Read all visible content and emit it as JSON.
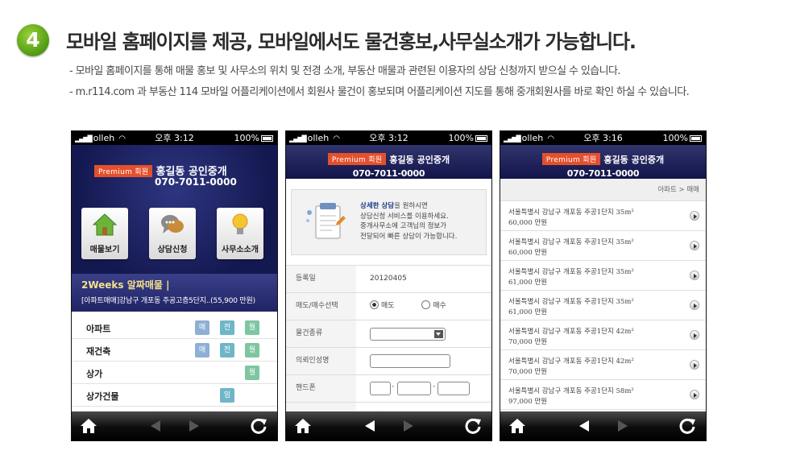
{
  "step_number": "4",
  "headline": "모바일 홈페이지를 제공, 모바일에서도 물건홍보,사무실소개가 가능합니다.",
  "descriptions": [
    "- 모바일 홈페이지를 통해 매물 홍보 및 사무소의 위치 및 전경 소개,  부동산 매물과 관련된  이용자의 상담 신청까지 받으실 수 있습니다.",
    "- m.r114.com 과 부동산 114 모바일 어플리케이션에서 회원사 물건이  홍보되며  어플리케이션 지도를 통해 중개회원사를 바로 확인 하실 수 있습니다."
  ],
  "status": {
    "carrier": "olleh",
    "battery": "100%",
    "times": [
      "오후 3:12",
      "오후 3:12",
      "오후 3:16"
    ]
  },
  "office": {
    "premium_label": "Premium 회원",
    "name": "홍길동 공인중개",
    "phone": "070-7011-0000"
  },
  "phone1": {
    "tiles": [
      {
        "label": "매물보기",
        "icon": "house-icon"
      },
      {
        "label": "상담신청",
        "icon": "chat-bubble-icon"
      },
      {
        "label": "사무소소개",
        "icon": "lightbulb-icon"
      }
    ],
    "banner_title": "2Weeks 알짜매물 |",
    "banner_item": "[아파트매매]강남구 개포동 주공고층5단지..(55,900 만원)",
    "categories": [
      {
        "name": "아파트",
        "tags": [
          "매",
          "전",
          "월"
        ]
      },
      {
        "name": "재건축",
        "tags": [
          "매",
          "전",
          "월"
        ]
      },
      {
        "name": "상가",
        "tags": [
          "",
          "",
          "월"
        ]
      },
      {
        "name": "상가건물",
        "tags": [
          "",
          "",
          "임"
        ]
      }
    ]
  },
  "phone2": {
    "info_title": "상세한 상담",
    "info_title_rest": "을 원하시면",
    "info_lines": [
      "상담신청 서비스를 이용하세요.",
      "중개사무소에 고객님의 정보가",
      "전달되어 빠른 상담이 가능합니다."
    ],
    "form": {
      "reg_date_label": "등록일",
      "reg_date_value": "20120405",
      "trade_label": "매도/매수선택",
      "trade_opt_sell": "매도",
      "trade_opt_buy": "매수",
      "type_label": "물건종류",
      "name_label": "의뢰인성명",
      "phone_label": "핸드폰",
      "phone_dash": "-"
    }
  },
  "phone3": {
    "breadcrumb": "아파트 > 매매",
    "listings": [
      {
        "address": "서울특별시 강남구 개포동 주공1단지 35m²",
        "price": "60,000 만원"
      },
      {
        "address": "서울특별시 강남구 개포동 주공1단지 35m²",
        "price": "60,000 만원"
      },
      {
        "address": "서울특별시 강남구 개포동 주공1단지 35m²",
        "price": "61,000 만원"
      },
      {
        "address": "서울특별시 강남구 개포동 주공1단지 35m²",
        "price": "61,000 만원"
      },
      {
        "address": "서울특별시 강남구 개포동 주공1단지 42m²",
        "price": "70,000 만원"
      },
      {
        "address": "서울특별시 강남구 개포동 주공1단지 42m²",
        "price": "70,000 만원"
      },
      {
        "address": "서울특별시 강남구 개포동 주공1단지 58m²",
        "price": "97,000 만원"
      }
    ]
  },
  "colors": {
    "header_navy": "#141850",
    "premium_red": "#e4502c",
    "step_green": "#5aa519"
  }
}
